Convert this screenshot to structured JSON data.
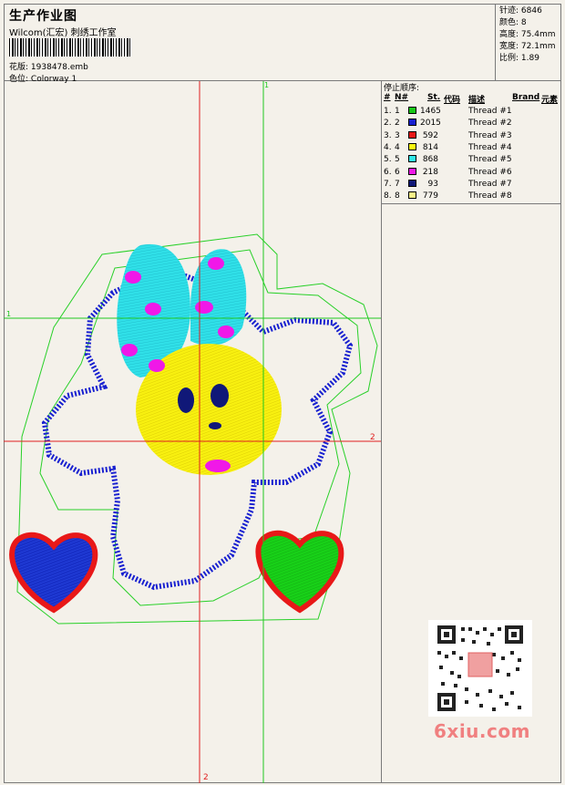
{
  "header": {
    "title": "生产作业图",
    "studio": "Wilcom(汇宏) 刺绣工作室",
    "design_label": "花版:",
    "design_value": "1938478.emb",
    "color_label": "色位:",
    "color_value": "Colorway 1"
  },
  "stats": [
    {
      "label": "针迹:",
      "value": "6846"
    },
    {
      "label": "颜色:",
      "value": "8"
    },
    {
      "label": "高度:",
      "value": "75.4mm"
    },
    {
      "label": "宽度:",
      "value": "72.1mm"
    },
    {
      "label": "比例:",
      "value": "1.89"
    }
  ],
  "stop_sequence": {
    "title": "停止顺序:",
    "columns": [
      "#",
      "N#",
      "St.",
      "代码",
      "描述",
      "Brand",
      "元素"
    ],
    "rows": [
      {
        "idx": "1.",
        "n": "1",
        "st": "1465",
        "desc": "Thread #1",
        "color": "#18c818"
      },
      {
        "idx": "2.",
        "n": "2",
        "st": "2015",
        "desc": "Thread #2",
        "color": "#1820d0"
      },
      {
        "idx": "3.",
        "n": "3",
        "st": "592",
        "desc": "Thread #3",
        "color": "#e81818"
      },
      {
        "idx": "4.",
        "n": "4",
        "st": "814",
        "desc": "Thread #4",
        "color": "#f8f810"
      },
      {
        "idx": "5.",
        "n": "5",
        "st": "868",
        "desc": "Thread #5",
        "color": "#30e8e8"
      },
      {
        "idx": "6.",
        "n": "6",
        "st": "218",
        "desc": "Thread #6",
        "color": "#f018e8"
      },
      {
        "idx": "7.",
        "n": "7",
        "st": "93",
        "desc": "Thread #7",
        "color": "#101878"
      },
      {
        "idx": "8.",
        "n": "8",
        "st": "779",
        "desc": "Thread #8",
        "color": "#f8f088"
      }
    ]
  },
  "guides": {
    "top": "1",
    "left": "1",
    "right": "2",
    "bottom": "2"
  },
  "colors": {
    "guide_red": "#e02020",
    "guide_green": "#20c820",
    "outline_green": "#28d028",
    "zigzag_blue": "#1820d0",
    "bow_cyan": "#30e0e8",
    "face_yellow": "#f8f010",
    "dot_magenta": "#f018e8",
    "heart_red": "#e81818",
    "heart_blue": "#1830c8",
    "heart_green": "#18d018"
  },
  "watermark": "6xiu.com"
}
